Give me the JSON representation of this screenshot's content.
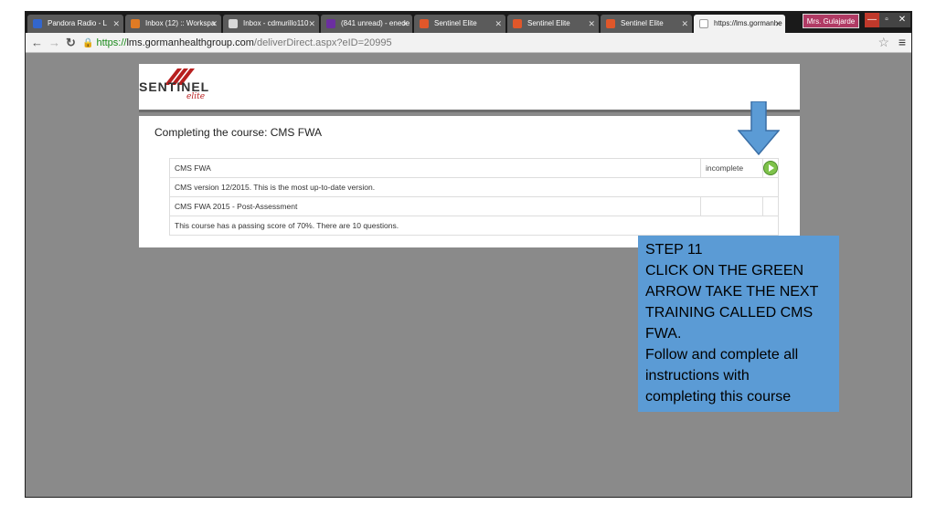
{
  "browser": {
    "tabs": [
      {
        "label": "Pandora Radio - L",
        "favicon_color": "#3366cc",
        "audio": true
      },
      {
        "label": "Inbox (12) :: Workspa",
        "favicon_color": "#e07b24"
      },
      {
        "label": "Inbox - cdmurillo110",
        "favicon_color": "#d8d8d8"
      },
      {
        "label": "(841 unread) - enede",
        "favicon_color": "#6b2fa0"
      },
      {
        "label": "Sentinel Elite",
        "favicon_color": "#e0572a"
      },
      {
        "label": "Sentinel Elite",
        "favicon_color": "#e0572a"
      },
      {
        "label": "Sentinel Elite",
        "favicon_color": "#e0572a"
      },
      {
        "label": "https://lms.gormanhe",
        "favicon_color": "#ffffff",
        "active": true
      }
    ],
    "user_badge": "Mrs. Gulajarde",
    "url_secure": "https://",
    "url_host": "lms.gormanhealthgroup.com",
    "url_path": "/deliverDirect.aspx?eID=20995"
  },
  "logo": {
    "wordmark": "SENTINEL",
    "sub": "elite"
  },
  "page": {
    "title": "Completing the course: CMS FWA"
  },
  "course_table": {
    "rows": [
      {
        "name": "CMS FWA",
        "status": "incomplete",
        "has_play": true
      },
      {
        "name": "CMS version 12/2015. This is the most up-to-date version.",
        "status": "",
        "span": true
      },
      {
        "name": "CMS FWA 2015 - Post-Assessment",
        "status": "",
        "has_play": false
      },
      {
        "name": "This course has a passing score of 70%. There are 10 questions.",
        "status": "",
        "span": true
      }
    ]
  },
  "callout": {
    "lines": [
      "STEP 11",
      "CLICK ON THE GREEN",
      "ARROW TAKE THE NEXT",
      "TRAINING CALLED CMS",
      "FWA.",
      "Follow and complete all",
      "instructions with",
      "completing this course"
    ]
  },
  "colors": {
    "callout_bg": "#5b9bd5",
    "play_green": "#7ec24a",
    "page_bg": "#8a8a8a",
    "brand_red": "#b81f1f"
  }
}
